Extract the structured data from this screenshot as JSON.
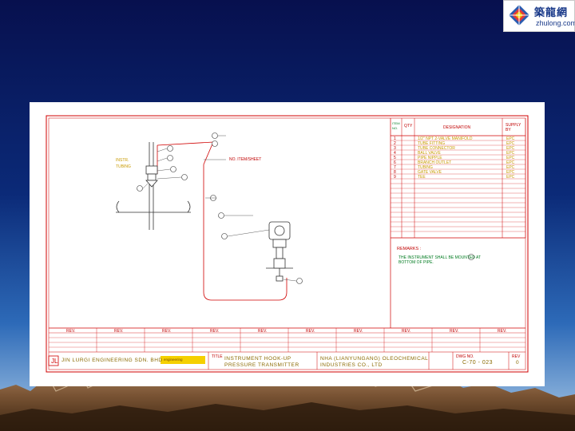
{
  "logo": {
    "cn": "築龍網",
    "en": "zhulong.com"
  },
  "drawing": {
    "callout_label": "NO. ITEM/SHEET",
    "side_note_1": "INSTR.",
    "side_note_2": "TUBING",
    "table_headers": {
      "item": "ITEM NO.",
      "qty": "QTY",
      "designation": "DESIGNATION",
      "supply": "SUPPLY BY"
    },
    "rows": [
      {
        "no": "1",
        "desc": "1/2\" NPT 2-VALVE MANIFOLD",
        "supply": "EPC"
      },
      {
        "no": "2",
        "desc": "TUBE FITTING",
        "supply": "EPC"
      },
      {
        "no": "3",
        "desc": "TUBE CONNECTOR",
        "supply": "EPC"
      },
      {
        "no": "4",
        "desc": "BALL VALVE",
        "supply": "EPC"
      },
      {
        "no": "5",
        "desc": "PIPE NIPPLE",
        "supply": "EPC"
      },
      {
        "no": "6",
        "desc": "BRANCH OUTLET",
        "supply": "EPC"
      },
      {
        "no": "7",
        "desc": "TUBING",
        "supply": "EPC"
      },
      {
        "no": "8",
        "desc": "GATE VALVE",
        "supply": "EPC"
      },
      {
        "no": "9",
        "desc": "TEE",
        "supply": "EPC"
      }
    ],
    "remarks_title": "REMARKS :",
    "remarks_text_1": "THE INSTRUMENT SHALL BE MOUNTED AT",
    "remarks_text_2": "BOTTOM OF PIPE.",
    "revisions": [
      "REV.",
      "REV.",
      "REV.",
      "REV.",
      "REV.",
      "REV.",
      "REV.",
      "REV.",
      "REV.",
      "REV."
    ],
    "company": "JIN LURGI ENGINEERING SDN. BHD",
    "firm_stamp": "engineering",
    "title_label": "TITLE",
    "title_line1": "INSTRUMENT HOOK-UP",
    "title_line2": "PRESSURE TRANSMITTER",
    "client_line1": "NHA (LIANYUNGANG) OLEOCHEMICAL",
    "client_line2": "INDUSTRIES CO., LTD",
    "dwg_label": "DWG NO.",
    "dwg_no": "C-70 - 023",
    "rev_label": "REV",
    "rev_no": "0"
  }
}
